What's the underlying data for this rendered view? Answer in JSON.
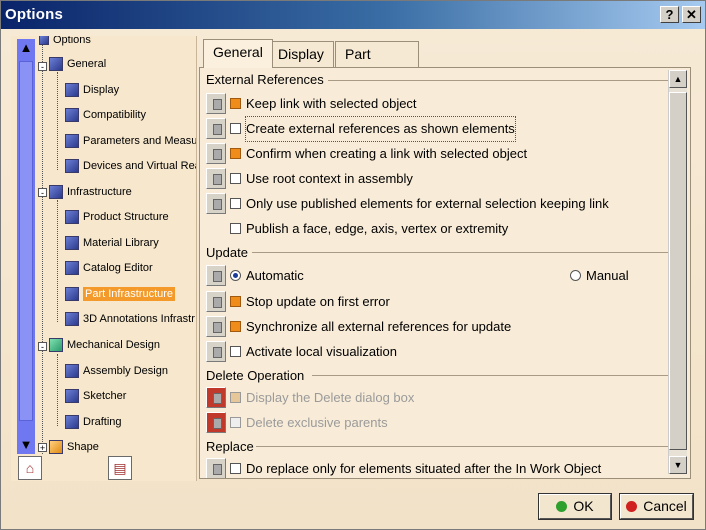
{
  "window": {
    "title": "Options",
    "help_label": "?",
    "close_label": "✕"
  },
  "tree": {
    "items": [
      {
        "label": "Options"
      },
      {
        "label": "General"
      },
      {
        "label": "Display"
      },
      {
        "label": "Compatibility"
      },
      {
        "label": "Parameters and Measur"
      },
      {
        "label": "Devices and Virtual Rea"
      },
      {
        "label": "Infrastructure"
      },
      {
        "label": "Product Structure"
      },
      {
        "label": "Material Library"
      },
      {
        "label": "Catalog Editor"
      },
      {
        "label": "Part Infrastructure"
      },
      {
        "label": "3D Annotations Infrastr"
      },
      {
        "label": "Mechanical Design"
      },
      {
        "label": "Assembly Design"
      },
      {
        "label": "Sketcher"
      },
      {
        "label": "Drafting"
      },
      {
        "label": "Shape"
      }
    ],
    "up_arrow": "▲",
    "down_arrow": "▼"
  },
  "tabs": [
    {
      "label": "General"
    },
    {
      "label": "Display"
    },
    {
      "label": "Part Document"
    }
  ],
  "groups": {
    "external_references": "External References",
    "update": "Update",
    "delete_operation": "Delete Operation",
    "replace": "Replace"
  },
  "external_refs": [
    {
      "label": "Keep link with selected object",
      "checked": true
    },
    {
      "label": "Create external references as shown elements",
      "checked": false
    },
    {
      "label": "Confirm when creating a link with selected object",
      "checked": true
    },
    {
      "label": "Use root context in assembly",
      "checked": false
    },
    {
      "label": "Only use published elements for external selection keeping link",
      "checked": false
    },
    {
      "label": "Publish a face, edge, axis, vertex or extremity",
      "checked": false
    }
  ],
  "update": {
    "automatic": "Automatic",
    "manual": "Manual",
    "items": [
      {
        "label": "Stop update on first error",
        "checked": true
      },
      {
        "label": "Synchronize all external references for update",
        "checked": true
      },
      {
        "label": "Activate local visualization",
        "checked": false
      }
    ]
  },
  "delete": [
    {
      "label": "Display the Delete dialog box",
      "checked": true
    },
    {
      "label": "Delete exclusive parents",
      "checked": false
    }
  ],
  "replace": [
    {
      "label": "Do replace only for elements situated after the In Work Object",
      "checked": false
    }
  ],
  "buttons": {
    "ok": "OK",
    "cancel": "Cancel"
  },
  "colors": {
    "ok_dot": "#2ea02e",
    "cancel_dot": "#d02020",
    "selected_tree": "#f39a2a",
    "checked": "#f08c1a"
  }
}
